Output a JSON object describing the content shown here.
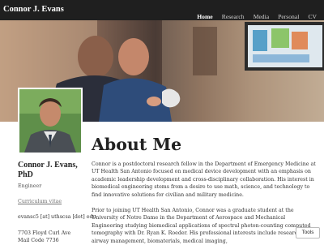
{
  "navbar": {
    "brand": "Connor J. Evans",
    "links": [
      "Home",
      "Research",
      "Media",
      "Personal",
      "CV"
    ],
    "active": "Home"
  },
  "hero": {
    "description": "photo-banner"
  },
  "sidebar": {
    "name": "Connor J. Evans, PhD",
    "role": "Engineer",
    "cv_link": "Curriculum vitae",
    "email": "evansc5 [at] uthscsa [dot] edu",
    "address_line1": "7703 Floyd Curl Ave",
    "address_line2": "Mail Code 7736"
  },
  "main": {
    "heading": "About Me",
    "paragraph1": "Connor is a postdoctoral research fellow in the Department of Emergency Medicine at UT Health San Antonio focused on medical device development with an emphasis on academic leadership development and cross-disciplinary collaboration. His interest in biomedical engineering stems from a desire to use math, science, and technology to find innovative solutions for civilian and military medicine.",
    "paragraph2": "Prior to joining UT Health San Antonio, Connor was a graduate student at the University of Notre Dame in the Department of Aerospace and Mechanical Engineering studying biomedical applications of spectral photon-counting computed tomography with Dr. Ryan K. Roeder. His professional interests include research in airway management, biomaterials, medical imaging,"
  },
  "tools_button": "Tools",
  "colors": {
    "navbar_bg": "#1f1f1f",
    "text": "#222222",
    "link": "#707070"
  }
}
